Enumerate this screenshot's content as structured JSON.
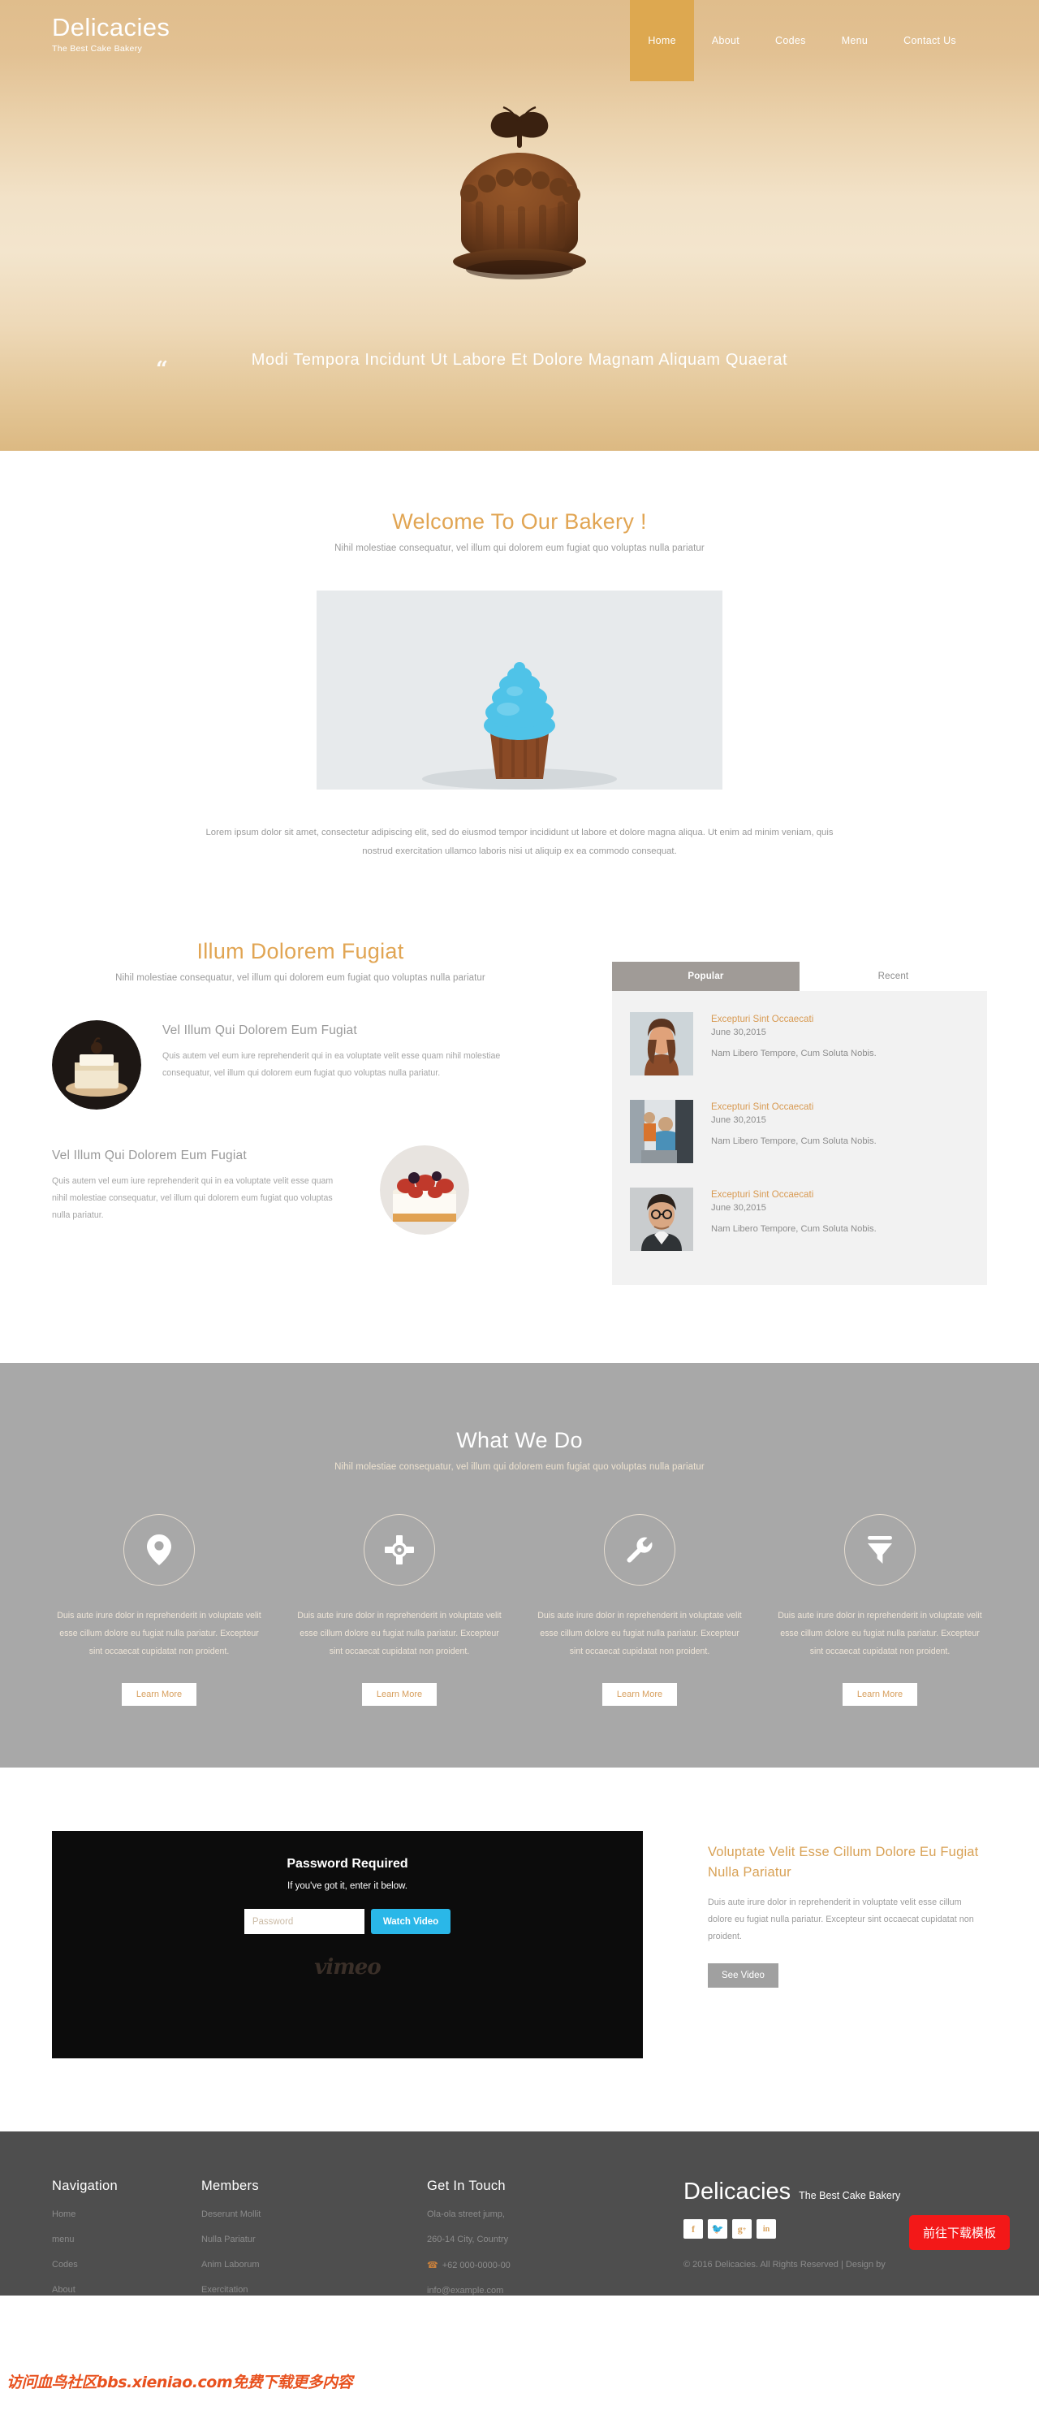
{
  "header": {
    "brand_title": "Delicacies",
    "brand_sub": "The Best Cake Bakery",
    "nav": [
      {
        "label": "Home",
        "active": true
      },
      {
        "label": "About",
        "active": false
      },
      {
        "label": "Codes",
        "active": false
      },
      {
        "label": "Menu",
        "active": false
      },
      {
        "label": "Contact Us",
        "active": false
      }
    ],
    "quote_mark": "“",
    "quote": "Modi Tempora Incidunt Ut Labore Et Dolore Magnam Aliquam Quaerat"
  },
  "welcome": {
    "title": "Welcome To Our Bakery !",
    "subtitle": "Nihil molestiae consequatur, vel illum qui dolorem eum fugiat quo voluptas nulla pariatur",
    "body": "Lorem ipsum dolor sit amet, consectetur adipiscing elit, sed do eiusmod tempor incididunt ut labore et dolore magna aliqua. Ut enim ad minim veniam, quis nostrud exercitation ullamco laboris nisi ut aliquip ex ea commodo consequat."
  },
  "illum": {
    "title": "Illum Dolorem Fugiat",
    "subtitle": "Nihil molestiae consequatur, vel illum qui dolorem eum fugiat quo voluptas nulla pariatur",
    "items": [
      {
        "title": "Vel Illum Qui Dolorem Eum Fugiat",
        "text": "Quis autem vel eum iure reprehenderit qui in ea voluptate velit esse quam nihil molestiae consequatur, vel illum qui dolorem eum fugiat quo voluptas nulla pariatur."
      },
      {
        "title": "Vel Illum Qui Dolorem Eum Fugiat",
        "text": "Quis autem vel eum iure reprehenderit qui in ea voluptate velit esse quam nihil molestiae consequatur, vel illum qui dolorem eum fugiat quo voluptas nulla pariatur."
      }
    ],
    "tabs": [
      {
        "label": "Popular",
        "active": true
      },
      {
        "label": "Recent",
        "active": false
      }
    ],
    "posts": [
      {
        "title": "Excepturi Sint Occaecati",
        "date": "June 30,2015",
        "desc": "Nam Libero Tempore, Cum Soluta Nobis.",
        "thumb": "woman-portrait-thumb"
      },
      {
        "title": "Excepturi Sint Occaecati",
        "date": "June 30,2015",
        "desc": "Nam Libero Tempore, Cum Soluta Nobis.",
        "thumb": "kitchen-workers-thumb"
      },
      {
        "title": "Excepturi Sint Occaecati",
        "date": "June 30,2015",
        "desc": "Nam Libero Tempore, Cum Soluta Nobis.",
        "thumb": "man-glasses-thumb"
      }
    ]
  },
  "whatwedo": {
    "title": "What We Do",
    "subtitle": "Nihil molestiae consequatur, vel illum qui dolorem eum fugiat quo voluptas nulla pariatur",
    "services": [
      {
        "icon": "map-pin-icon",
        "text": "Duis aute irure dolor in reprehenderit in voluptate velit esse cillum dolore eu fugiat nulla pariatur. Excepteur sint occaecat cupidatat non proident.",
        "button": "Learn More"
      },
      {
        "icon": "crosshair-target-icon",
        "text": "Duis aute irure dolor in reprehenderit in voluptate velit esse cillum dolore eu fugiat nulla pariatur. Excepteur sint occaecat cupidatat non proident.",
        "button": "Learn More"
      },
      {
        "icon": "wrench-icon",
        "text": "Duis aute irure dolor in reprehenderit in voluptate velit esse cillum dolore eu fugiat nulla pariatur. Excepteur sint occaecat cupidatat non proident.",
        "button": "Learn More"
      },
      {
        "icon": "funnel-filter-icon",
        "text": "Duis aute irure dolor in reprehenderit in voluptate velit esse cillum dolore eu fugiat nulla pariatur. Excepteur sint occaecat cupidatat non proident.",
        "button": "Learn More"
      }
    ]
  },
  "video": {
    "password_title": "Password Required",
    "password_sub": "If you've got it, enter it below.",
    "password_placeholder": "Password",
    "password_value": "",
    "watch_button": "Watch Video",
    "provider_logo": "vimeo",
    "side_title": "Voluptate Velit Esse Cillum Dolore Eu Fugiat Nulla Pariatur",
    "side_text": "Duis aute irure dolor in reprehenderit in voluptate velit esse cillum dolore eu fugiat nulla pariatur. Excepteur sint occaecat cupidatat non proident.",
    "side_button": "See Video"
  },
  "footer": {
    "nav_title": "Navigation",
    "nav_links": [
      "Home",
      "menu",
      "Codes",
      "About"
    ],
    "members_title": "Members",
    "members_links": [
      "Deserunt Mollit",
      "Nulla Pariatur",
      "Anim Laborum",
      "Exercitation"
    ],
    "touch_title": "Get In Touch",
    "address1": "Ola-ola street jump,",
    "address2": "260-14 City, Country",
    "phone": "+62 000-0000-00",
    "email": "info@example.com",
    "brand_title": "Delicacies",
    "brand_sub": "The Best Cake Bakery",
    "socials": [
      "facebook-icon",
      "twitter-icon",
      "google-plus-icon",
      "linkedin-icon"
    ],
    "copyright": "© 2016 Delicacies. All Rights Reserved | Design by",
    "download_button": "前往下载模板"
  },
  "watermark": {
    "text": "访问血鸟社区bbs.xieniao.com免费下载更多内容"
  },
  "colors": {
    "accent": "#d89a52",
    "header_bg": "#e0bd8c",
    "nav_active": "#dda850",
    "gray_section": "#a8a8a8",
    "footer_bg": "#4e4e4e",
    "video_btn": "#2ab7e8",
    "download_btn": "#f31818"
  }
}
